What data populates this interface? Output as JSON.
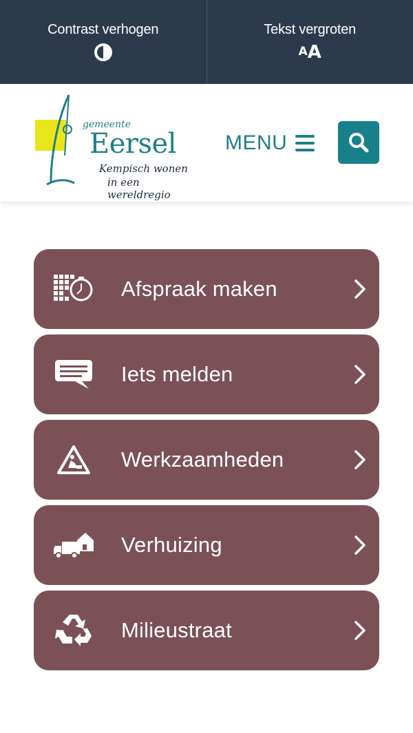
{
  "accessibility_bar": {
    "contrast": {
      "label": "Contrast verhogen",
      "icon": "contrast-icon"
    },
    "text_size": {
      "label": "Tekst vergroten",
      "icon_small": "A",
      "icon_big": "A"
    }
  },
  "header": {
    "logo": {
      "sub": "gemeente",
      "title": "Eersel",
      "tagline_line1": "Kempisch wonen",
      "tagline_line2": "in een wereldregio"
    },
    "menu_label": "MENU",
    "search_icon": "search-icon"
  },
  "colors": {
    "topbar": "#2d3a4b",
    "brand_teal": "#1f7f86",
    "tile": "#7b5157",
    "logo_yellow": "#e9e51b"
  },
  "tiles": [
    {
      "label": "Afspraak maken",
      "icon": "calendar-clock-icon"
    },
    {
      "label": "Iets melden",
      "icon": "speech-bubble-icon"
    },
    {
      "label": "Werkzaamheden",
      "icon": "roadwork-icon"
    },
    {
      "label": "Verhuizing",
      "icon": "moving-truck-icon"
    },
    {
      "label": "Milieustraat",
      "icon": "recycle-icon"
    }
  ]
}
